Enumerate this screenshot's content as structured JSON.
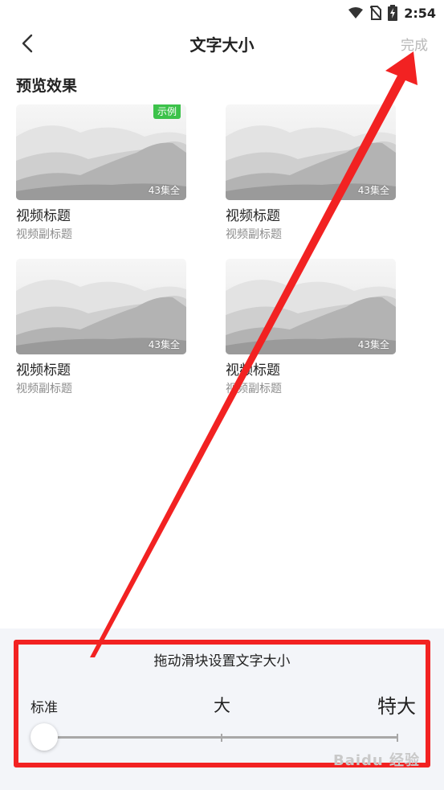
{
  "status_bar": {
    "time": "2:54"
  },
  "header": {
    "title": "文字大小",
    "done_label": "完成"
  },
  "preview": {
    "section_title": "预览效果",
    "badge": "示例",
    "cards": [
      {
        "title": "视频标题",
        "subtitle": "视频副标题",
        "count": "43集全"
      },
      {
        "title": "视频标题",
        "subtitle": "视频副标题",
        "count": "43集全"
      },
      {
        "title": "视频标题",
        "subtitle": "视频副标题",
        "count": "43集全"
      },
      {
        "title": "视频标题",
        "subtitle": "视频副标题",
        "count": "43集全"
      }
    ]
  },
  "font_panel": {
    "hint": "拖动滑块设置文字大小",
    "levels": [
      "标准",
      "大",
      "特大"
    ],
    "selected_level": "标准"
  },
  "watermark": "Baidu 经验",
  "colors": {
    "annotation": "#f22222",
    "badge": "#3cc24a",
    "panel_bg": "#f3f5f9"
  }
}
